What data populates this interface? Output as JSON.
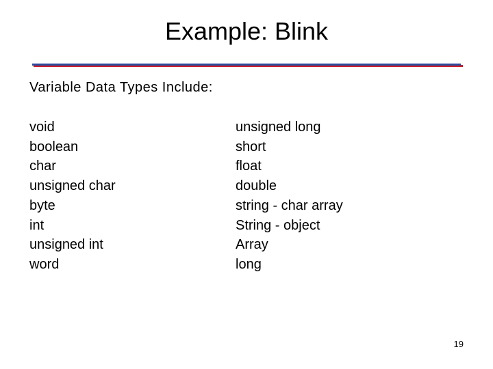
{
  "slide": {
    "title": "Example: Blink",
    "subtitle": "Variable Data Types Include:",
    "left_column": [
      "void",
      "boolean",
      "char",
      "unsigned char",
      "byte",
      "int",
      "unsigned int",
      "word"
    ],
    "right_column": [
      "unsigned long",
      "short",
      "float",
      "double",
      "string - char array",
      "String - object",
      "Array",
      "long"
    ],
    "page_number": "19",
    "colors": {
      "rule_blue": "#2b4a9a",
      "rule_red": "#cc1f2e"
    }
  }
}
